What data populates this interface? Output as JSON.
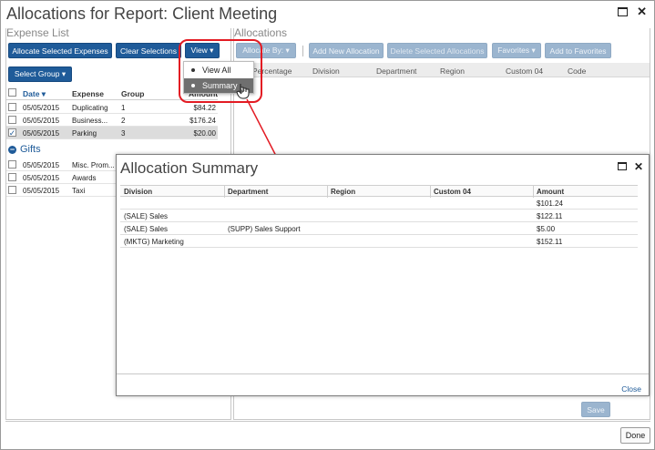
{
  "window": {
    "title": "Allocations for Report: Client Meeting"
  },
  "left_pane": {
    "title": "Expense List",
    "buttons": {
      "allocate_selected": "Allocate Selected Expenses",
      "clear_selections": "Clear Selections",
      "view": "View ▾",
      "select_group": "Select Group ▾"
    },
    "columns": {
      "date": "Date ▾",
      "expense": "Expense",
      "group": "Group",
      "amount": "Amount"
    },
    "rows": [
      {
        "date": "05/05/2015",
        "expense": "Duplicating",
        "group": "1",
        "amount": "$84.22",
        "checked": false
      },
      {
        "date": "05/05/2015",
        "expense": "Business...",
        "group": "2",
        "amount": "$176.24",
        "checked": false
      },
      {
        "date": "05/05/2015",
        "expense": "Parking",
        "group": "3",
        "amount": "$20.00",
        "checked": true
      }
    ],
    "gifts_label": "Gifts",
    "gift_rows": [
      {
        "date": "05/05/2015",
        "expense": "Misc. Prom..."
      },
      {
        "date": "05/05/2015",
        "expense": "Awards"
      },
      {
        "date": "05/05/2015",
        "expense": "Taxi"
      }
    ]
  },
  "view_menu": {
    "items": [
      {
        "label": "View All"
      },
      {
        "label": "Summary"
      }
    ]
  },
  "right_pane": {
    "title": "Allocations",
    "buttons": {
      "allocate_by": "Allocate By: ▾",
      "add_new": "Add New Allocation",
      "delete_selected": "Delete Selected Allocations",
      "favorites": "Favorites ▾",
      "add_to_favorites": "Add to Favorites"
    },
    "columns": {
      "percentage": "Percentage",
      "division": "Division",
      "department": "Department",
      "region": "Region",
      "custom04": "Custom 04",
      "code": "Code"
    },
    "save": "Save"
  },
  "summary_modal": {
    "title": "Allocation Summary",
    "columns": {
      "division": "Division",
      "department": "Department",
      "region": "Region",
      "custom04": "Custom 04",
      "amount": "Amount"
    },
    "rows": [
      {
        "division": "",
        "department": "",
        "region": "",
        "custom04": "",
        "amount": "$101.24"
      },
      {
        "division": "(SALE) Sales",
        "department": "",
        "region": "",
        "custom04": "",
        "amount": "$122.11"
      },
      {
        "division": "(SALE) Sales",
        "department": "(SUPP) Sales Support",
        "region": "",
        "custom04": "",
        "amount": "$5.00"
      },
      {
        "division": "(MKTG) Marketing",
        "department": "",
        "region": "",
        "custom04": "",
        "amount": "$152.11"
      }
    ],
    "close": "Close"
  },
  "footer": {
    "done": "Done"
  },
  "colors": {
    "primary_button": "#1f5b99",
    "callout": "#e31b23",
    "link": "#1f5b99"
  }
}
